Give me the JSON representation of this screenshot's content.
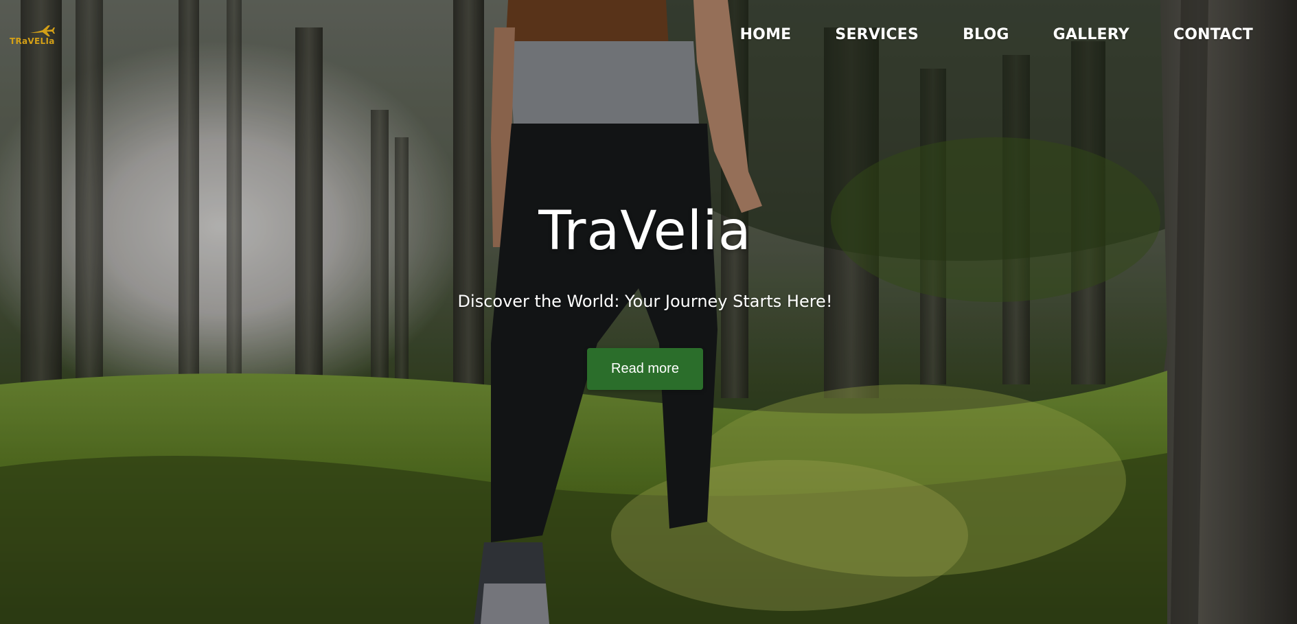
{
  "brand": {
    "logo_text": "TRaVELIa",
    "logo_icon": "airplane-icon",
    "logo_color": "#d4a017"
  },
  "nav": {
    "items": [
      {
        "label": "HOME"
      },
      {
        "label": "SERVICES"
      },
      {
        "label": "BLOG"
      },
      {
        "label": "GALLERY"
      },
      {
        "label": "CONTACT"
      }
    ]
  },
  "hero": {
    "title": "TraVelia",
    "subtitle": "Discover the World: Your Journey Starts Here!",
    "cta_label": "Read more",
    "cta_color": "#2b6e2b",
    "background": "hiker walking through a sunlit pine forest"
  }
}
